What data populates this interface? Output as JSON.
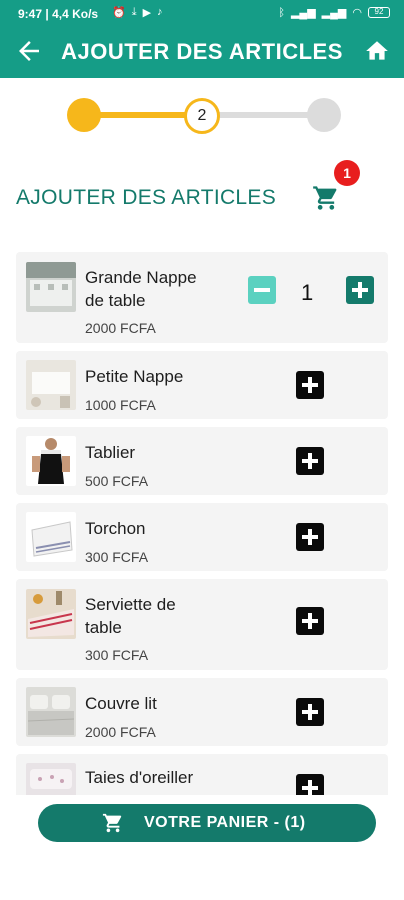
{
  "status_bar": {
    "time": "9:47",
    "speed": "4,4 Ko/s",
    "battery": "92"
  },
  "app_bar": {
    "title": "AJOUTER DES ARTICLES"
  },
  "stepper": {
    "current_step": "2",
    "total_steps": 3
  },
  "section": {
    "title": "AJOUTER DES ARTICLES",
    "cart_count": "1"
  },
  "items": [
    {
      "name_l1": "Grande Nappe",
      "name_l2": "de table",
      "price": "2000 FCFA",
      "quantity": "1"
    },
    {
      "name_l1": "Petite Nappe",
      "price": "1000 FCFA"
    },
    {
      "name_l1": "Tablier",
      "price": "500 FCFA"
    },
    {
      "name_l1": "Torchon",
      "price": "300 FCFA"
    },
    {
      "name_l1": "Serviette de",
      "name_l2": "table",
      "price": "300 FCFA"
    },
    {
      "name_l1": "Couvre lit",
      "price": "2000 FCFA"
    },
    {
      "name_l1": "Taies d'oreiller"
    }
  ],
  "cart_button": {
    "label": "VOTRE PANIER - (1)"
  },
  "colors": {
    "primary": "#159d87",
    "dark_green": "#147a6b",
    "accent_yellow": "#f6b71b",
    "badge_red": "#e81e1e",
    "minus_teal": "#5bd1c0"
  },
  "icons": [
    "back-arrow-icon",
    "home-icon",
    "cart-icon",
    "plus-icon",
    "minus-icon"
  ]
}
